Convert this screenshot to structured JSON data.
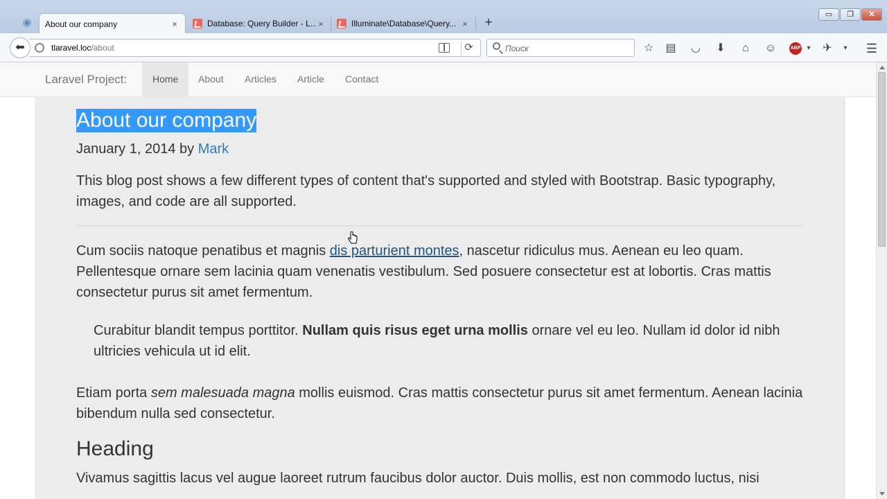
{
  "browser": {
    "tabs": [
      {
        "label": "About our company",
        "active": true
      },
      {
        "label": "Database: Query Builder - L...",
        "active": false
      },
      {
        "label": "Illuminate\\Database\\Query...",
        "active": false
      }
    ],
    "tab_close_glyph": "×",
    "new_tab_glyph": "+",
    "window_controls": {
      "minimize": "▭",
      "restore": "❐",
      "close": "✕"
    },
    "url": {
      "host": "tlaravel.loc",
      "path": "/about"
    },
    "search_placeholder": "Поиск",
    "toolbar_icons": [
      "star-icon",
      "reading-list-icon",
      "pocket-icon",
      "download-icon",
      "home-icon",
      "chat-icon",
      "adblock-icon",
      "extension-icon",
      "overflow-icon",
      "menu-icon"
    ],
    "abp_label": "ABP"
  },
  "site": {
    "brand": "Laravel Project:",
    "nav": [
      "Home",
      "About",
      "Articles",
      "Article",
      "Contact"
    ],
    "active_nav": "Home"
  },
  "post": {
    "title": "About our company",
    "meta_prefix": "January 1, 2014 by ",
    "author": "Mark",
    "lead": "This blog post shows a few different types of content that's supported and styled with Bootstrap. Basic typography, images, and code are all supported.",
    "p1_before": "Cum sociis natoque penatibus et magnis ",
    "p1_link": "dis parturient montes",
    "p1_after": ", nascetur ridiculus mus. Aenean eu leo quam. Pellentesque ornare sem lacinia quam venenatis vestibulum. Sed posuere consectetur est at lobortis. Cras mattis consectetur purus sit amet fermentum.",
    "quote_before": "Curabitur blandit tempus porttitor. ",
    "quote_bold": "Nullam quis risus eget urna mollis",
    "quote_after": " ornare vel eu leo. Nullam id dolor id nibh ultricies vehicula ut id elit.",
    "p2_before": "Etiam porta ",
    "p2_italic": "sem malesuada magna",
    "p2_after": " mollis euismod. Cras mattis consectetur purus sit amet fermentum. Aenean lacinia bibendum nulla sed consectetur.",
    "heading": "Heading",
    "p3": "Vivamus sagittis lacus vel augue laoreet rutrum faucibus dolor auctor. Duis mollis, est non commodo luctus, nisi"
  },
  "colors": {
    "selection": "#3399ff",
    "link": "#337ab7",
    "content_bg": "#ececec"
  }
}
